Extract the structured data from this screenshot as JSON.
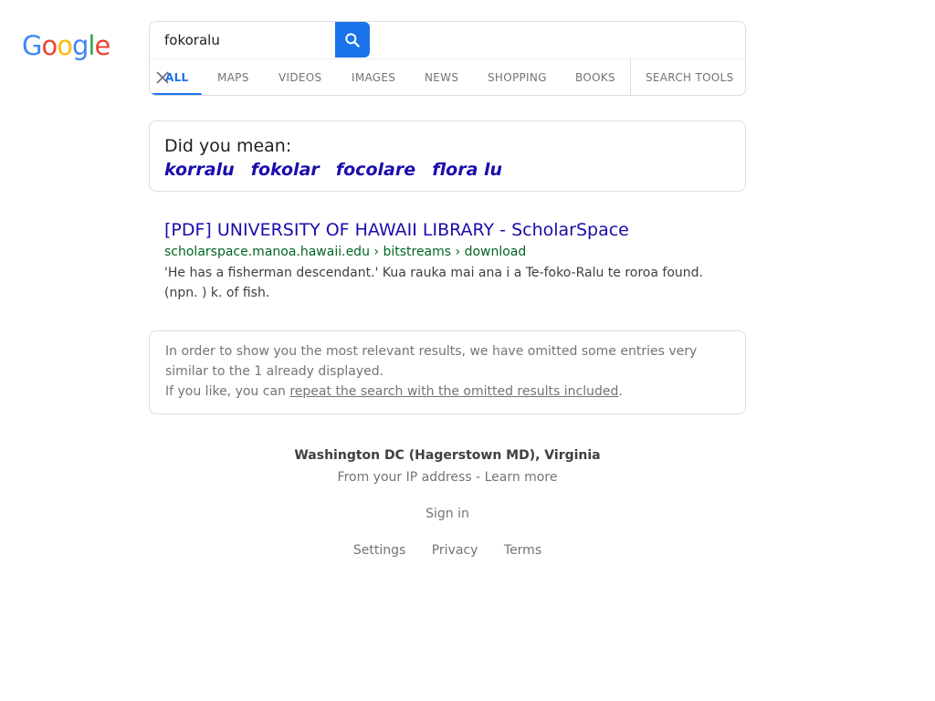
{
  "logo": {
    "letters": [
      "G",
      "o",
      "o",
      "g",
      "l",
      "e"
    ],
    "colors": [
      "#4285f4",
      "#ea4335",
      "#fbbc05",
      "#4285f4",
      "#34a853",
      "#ea4335"
    ]
  },
  "search": {
    "query": "fokoralu",
    "button_icon": "search-icon"
  },
  "tabs": [
    {
      "label": "ALL",
      "active": true
    },
    {
      "label": "MAPS"
    },
    {
      "label": "VIDEOS"
    },
    {
      "label": "IMAGES"
    },
    {
      "label": "NEWS"
    },
    {
      "label": "SHOPPING"
    },
    {
      "label": "BOOKS"
    },
    {
      "label": "SEARCH TOOLS"
    }
  ],
  "did_you_mean": {
    "label": "Did you mean:",
    "suggestions": [
      "korralu",
      "fokolar",
      "focolare",
      "flora lu"
    ]
  },
  "result": {
    "title": "[PDF] UNIVERSITY OF HAWAII LIBRARY - ScholarSpace",
    "url": "scholarspace.manoa.hawaii.edu › bitstreams › download",
    "snippet_line1": "'He has a fisherman descendant.' Kua rauka mai ana i a Te-foko-Ralu te roroa found.",
    "snippet_line2": "(npn. ) k. of fish."
  },
  "omitted": {
    "line1": "In order to show you the most relevant results, we have omitted some entries very",
    "line2": "similar to the 1 already displayed.",
    "line3_prefix": "If you like, you can ",
    "line3_link": "repeat the search with the omitted results included",
    "line3_suffix": "."
  },
  "footer": {
    "location": "Washington DC (Hagerstown MD), Virginia",
    "ip_text": "From your IP address",
    "ip_sep": " - ",
    "learn_more": "Learn more",
    "sign_in": "Sign in",
    "links": [
      "Settings",
      "Privacy",
      "Terms"
    ]
  },
  "colors": {
    "accent": "#1a73e8",
    "link": "#1a0dab",
    "url_green": "#006621"
  }
}
